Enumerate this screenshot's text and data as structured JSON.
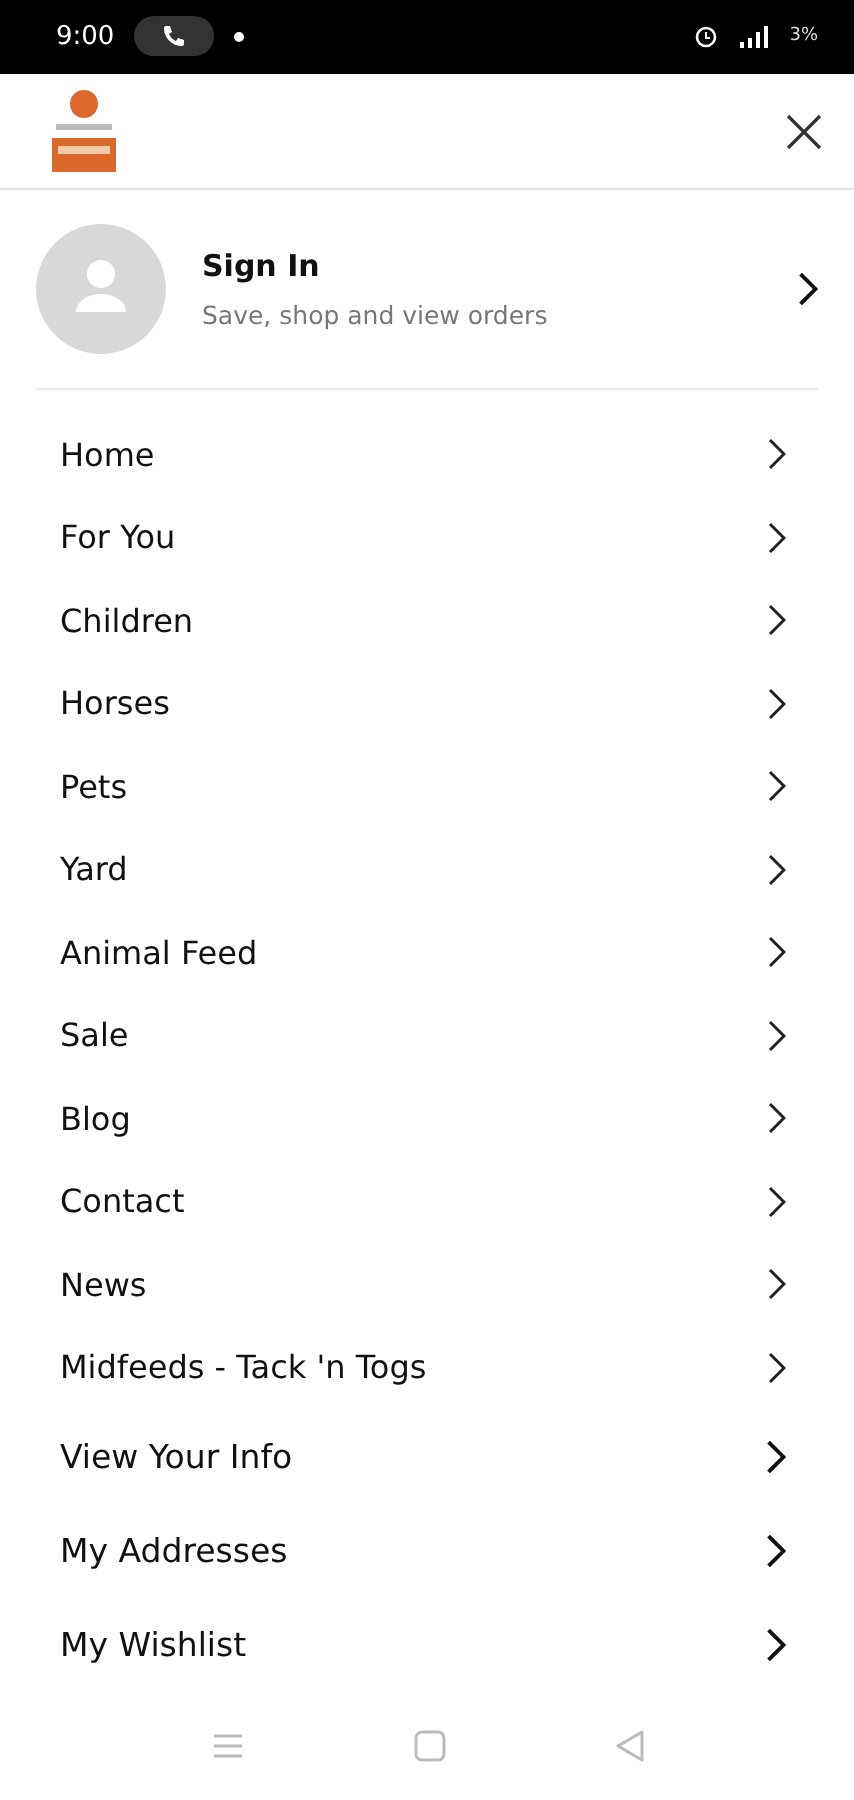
{
  "status_bar": {
    "time": "9:00",
    "battery": "3%"
  },
  "account": {
    "title": "Sign In",
    "subtitle": "Save, shop and view orders"
  },
  "menu": [
    {
      "label": "Home",
      "kind": "category"
    },
    {
      "label": "For You",
      "kind": "category"
    },
    {
      "label": "Children",
      "kind": "category"
    },
    {
      "label": "Horses",
      "kind": "category"
    },
    {
      "label": "Pets",
      "kind": "category"
    },
    {
      "label": "Yard",
      "kind": "category"
    },
    {
      "label": "Animal Feed",
      "kind": "category"
    },
    {
      "label": "Sale",
      "kind": "category"
    },
    {
      "label": "Blog",
      "kind": "category"
    },
    {
      "label": "Contact",
      "kind": "category"
    },
    {
      "label": "News",
      "kind": "category"
    },
    {
      "label": "Midfeeds - Tack 'n Togs",
      "kind": "category"
    },
    {
      "label": "View Your Info",
      "kind": "account"
    },
    {
      "label": "My Addresses",
      "kind": "account"
    },
    {
      "label": "My Wishlist",
      "kind": "account"
    }
  ]
}
